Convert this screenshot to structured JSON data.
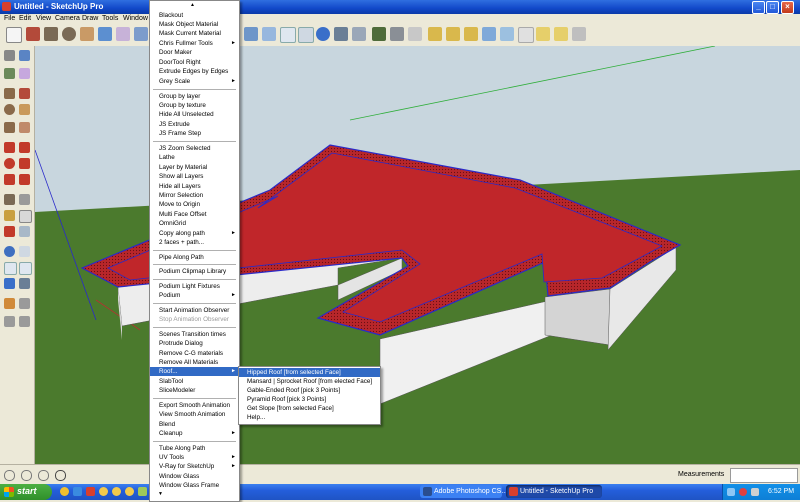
{
  "window": {
    "title": "Untitled - SketchUp Pro",
    "min": "_",
    "max": "□",
    "close": "×"
  },
  "menubar": [
    "File",
    "Edit",
    "View",
    "Camera",
    "Draw",
    "Tools",
    "Window"
  ],
  "plugins_menu": {
    "items": [
      {
        "label": "Blackout"
      },
      {
        "label": "Mask Object Material"
      },
      {
        "label": "Mask Current Material"
      },
      {
        "label": "Chris Fullmer Tools",
        "submenu": true
      },
      {
        "label": "Door Maker"
      },
      {
        "label": "DoorTool Right"
      },
      {
        "label": "Extrude Edges by Edges"
      },
      {
        "label": "Grey Scale",
        "submenu": true
      },
      {
        "label": "Group by layer"
      },
      {
        "label": "Group by texture"
      },
      {
        "label": "Hide All Unselected"
      },
      {
        "label": "JS Extrude"
      },
      {
        "label": "JS Frame Step"
      },
      {
        "label": "JS Zoom Selected"
      },
      {
        "label": "Lathe"
      },
      {
        "label": "Layer by Material"
      },
      {
        "label": "Show all Layers"
      },
      {
        "label": "Hide all Layers"
      },
      {
        "label": "Mirror Selection"
      },
      {
        "label": "Move to Origin"
      },
      {
        "label": "Multi Face Offset"
      },
      {
        "label": "OmniGrid"
      },
      {
        "label": "Copy along path",
        "submenu": true
      },
      {
        "label": "2 faces + path..."
      },
      {
        "label": "Pipe Along Path"
      },
      {
        "label": "Podium Clipmap Library"
      },
      {
        "label": "Podium Light Fixtures"
      },
      {
        "label": "Podium",
        "submenu": true
      },
      {
        "label": "Start Animation Observer"
      },
      {
        "label": "Stop Animation Observer",
        "disabled": true
      },
      {
        "label": "Scenes Transition times"
      },
      {
        "label": "Protrude Dialog"
      },
      {
        "label": "Remove C-G materials"
      },
      {
        "label": "Remove All Materials"
      },
      {
        "label": "Roof...",
        "submenu": true,
        "highlighted": true
      },
      {
        "label": "SlabTool"
      },
      {
        "label": "SliceModeler"
      },
      {
        "label": "Export Smooth Animation"
      },
      {
        "label": "View Smooth Animation"
      },
      {
        "label": "Blend"
      },
      {
        "label": "Cleanup",
        "submenu": true
      },
      {
        "label": "Tube Along Path"
      },
      {
        "label": "UV Tools",
        "submenu": true
      },
      {
        "label": "V-Ray for SketchUp",
        "submenu": true
      },
      {
        "label": "Window Glass"
      },
      {
        "label": "Window Glass Frame"
      }
    ],
    "scroll_up": "▲",
    "scroll_down": "▼"
  },
  "roof_submenu": [
    {
      "label": "Hipped Roof [from selected Face]",
      "highlighted": true
    },
    {
      "label": "Mansard | Sprocket Roof [from elected Face]"
    },
    {
      "label": "Gable-Ended Roof [pick 3 Points]"
    },
    {
      "label": "Pyramid Roof [pick 3 Points]"
    },
    {
      "label": "Get Slope [from selected Face]"
    },
    {
      "label": "Help..."
    }
  ],
  "statusbar": {
    "measurements_label": "Measurements"
  },
  "taskbar": {
    "start": "start",
    "tasks": [
      {
        "label": "Adobe Photoshop CS...",
        "icon_color": "#2a4e8f"
      },
      {
        "label": "Untitled - SketchUp Pro",
        "icon_color": "#d73f2e",
        "active": true
      }
    ],
    "clock": "6:52 PM"
  },
  "colors": {
    "sky": "#c8d6de",
    "ground": "#4b7a2d",
    "roof_face": "#c0262a",
    "roof_outline": "#2a2ac9",
    "menu_highlight": "#316ac5",
    "titlebar": "#1148c9"
  }
}
